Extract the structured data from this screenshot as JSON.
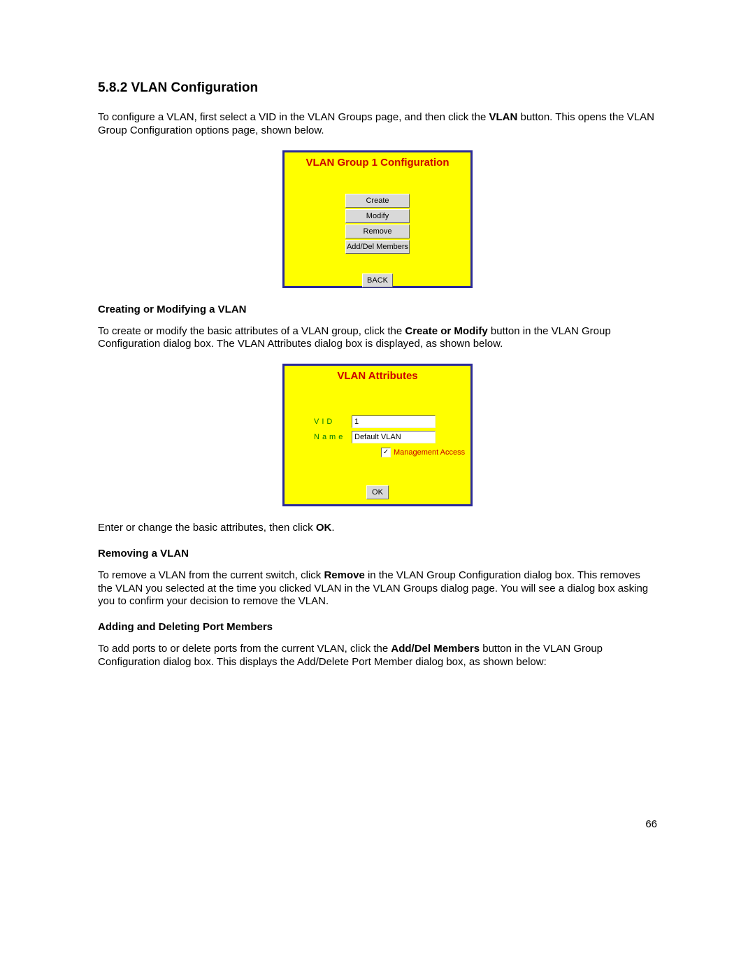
{
  "section": {
    "number_title": "5.8.2 VLAN Configuration",
    "intro_pre": "To configure a VLAN, first select a VID in the VLAN Groups page, and then click the ",
    "intro_bold": "VLAN",
    "intro_post": " button. This opens the VLAN Group Configuration options page, shown below."
  },
  "dialog1": {
    "title": "VLAN Group 1 Configuration",
    "buttons": {
      "create": "Create",
      "modify": "Modify",
      "remove": "Remove",
      "adddel": "Add/Del Members",
      "back": "BACK"
    }
  },
  "sub1": {
    "heading": "Creating or Modifying a VLAN",
    "p_pre": "To create or modify the basic attributes of a VLAN group, click the ",
    "p_bold": "Create or Modify",
    "p_post": " button in the VLAN Group Configuration dialog box. The VLAN Attributes dialog box is displayed, as shown below."
  },
  "dialog2": {
    "title": "VLAN Attributes",
    "vid_label": "VID",
    "vid_value": "1",
    "name_label": "Name",
    "name_value": "Default VLAN",
    "mgmt_label": "Management Access",
    "mgmt_checked": true,
    "ok_label": "OK"
  },
  "after_d2": {
    "p_pre": "Enter or change the basic attributes, then click ",
    "p_bold": "OK",
    "p_post": "."
  },
  "sub2": {
    "heading": "Removing a VLAN",
    "p_pre": "To remove a VLAN from the current switch, click ",
    "p_bold": "Remove",
    "p_post": " in the VLAN Group Configuration dialog box. This removes the VLAN you selected at the time you clicked VLAN in the VLAN Groups dialog page. You will see a dialog box asking you to confirm your decision to remove the VLAN."
  },
  "sub3": {
    "heading": "Adding and Deleting Port Members",
    "p_pre": "To add ports to or delete ports from the current VLAN, click the ",
    "p_bold": "Add/Del Members",
    "p_post": " button in the VLAN Group Configuration dialog box. This displays the Add/Delete Port Member dialog box, as shown below:"
  },
  "page_number": "66"
}
